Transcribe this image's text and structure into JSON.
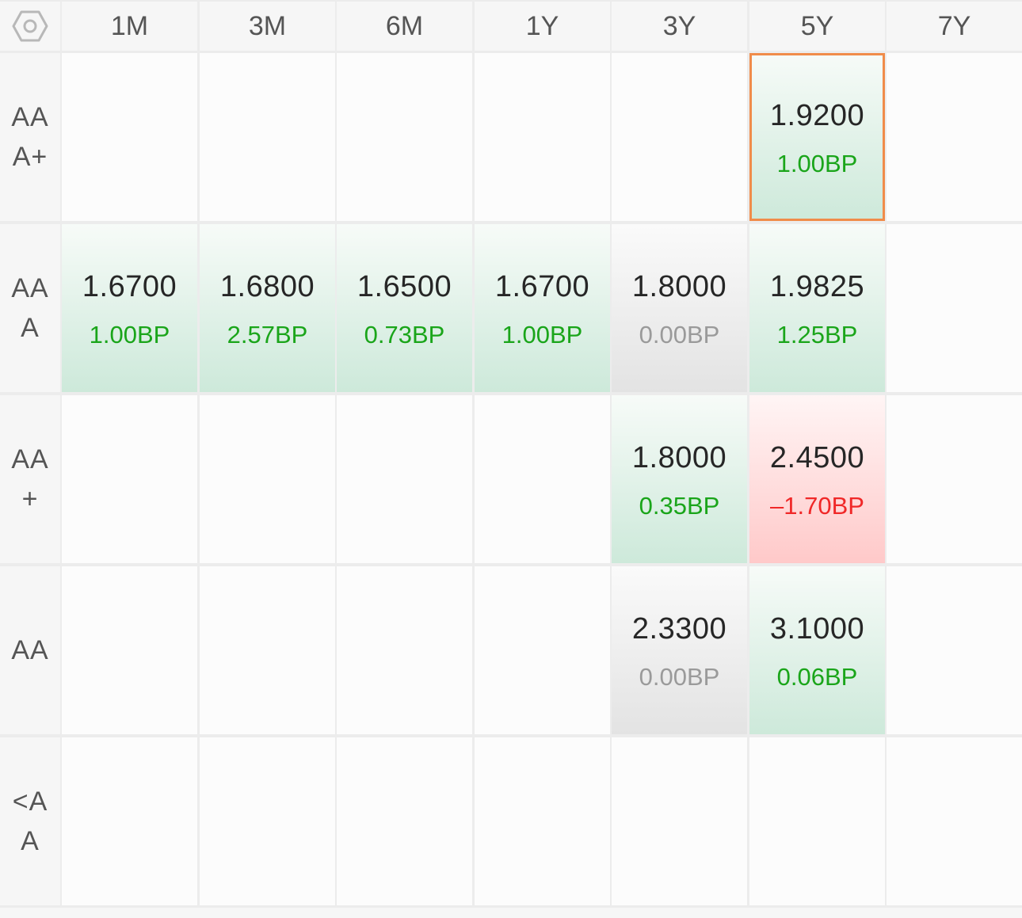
{
  "settings_icon": "hexagon-settings-icon",
  "columns": [
    "1M",
    "3M",
    "6M",
    "1Y",
    "3Y",
    "5Y",
    "7Y"
  ],
  "rows": [
    {
      "label": "AAA+",
      "cells": [
        null,
        null,
        null,
        null,
        null,
        {
          "value": "1.9200",
          "change": "1.00BP",
          "trend": "up",
          "selected": true
        },
        null
      ]
    },
    {
      "label": "AAA",
      "cells": [
        {
          "value": "1.6700",
          "change": "1.00BP",
          "trend": "up"
        },
        {
          "value": "1.6800",
          "change": "2.57BP",
          "trend": "up"
        },
        {
          "value": "1.6500",
          "change": "0.73BP",
          "trend": "up"
        },
        {
          "value": "1.6700",
          "change": "1.00BP",
          "trend": "up"
        },
        {
          "value": "1.8000",
          "change": "0.00BP",
          "trend": "flat"
        },
        {
          "value": "1.9825",
          "change": "1.25BP",
          "trend": "up"
        },
        null
      ]
    },
    {
      "label": "AA+",
      "cells": [
        null,
        null,
        null,
        null,
        {
          "value": "1.8000",
          "change": "0.35BP",
          "trend": "up"
        },
        {
          "value": "2.4500",
          "change": "–1.70BP",
          "trend": "down"
        },
        null
      ]
    },
    {
      "label": "AA",
      "cells": [
        null,
        null,
        null,
        null,
        {
          "value": "2.3300",
          "change": "0.00BP",
          "trend": "flat"
        },
        {
          "value": "3.1000",
          "change": "0.06BP",
          "trend": "up"
        },
        null
      ]
    },
    {
      "label": "<AA",
      "cells": [
        null,
        null,
        null,
        null,
        null,
        null,
        null
      ]
    }
  ],
  "colors": {
    "up": "#1aa51a",
    "flat": "#9a9a9a",
    "down": "#f02828",
    "selected_border": "#f08c4a"
  }
}
